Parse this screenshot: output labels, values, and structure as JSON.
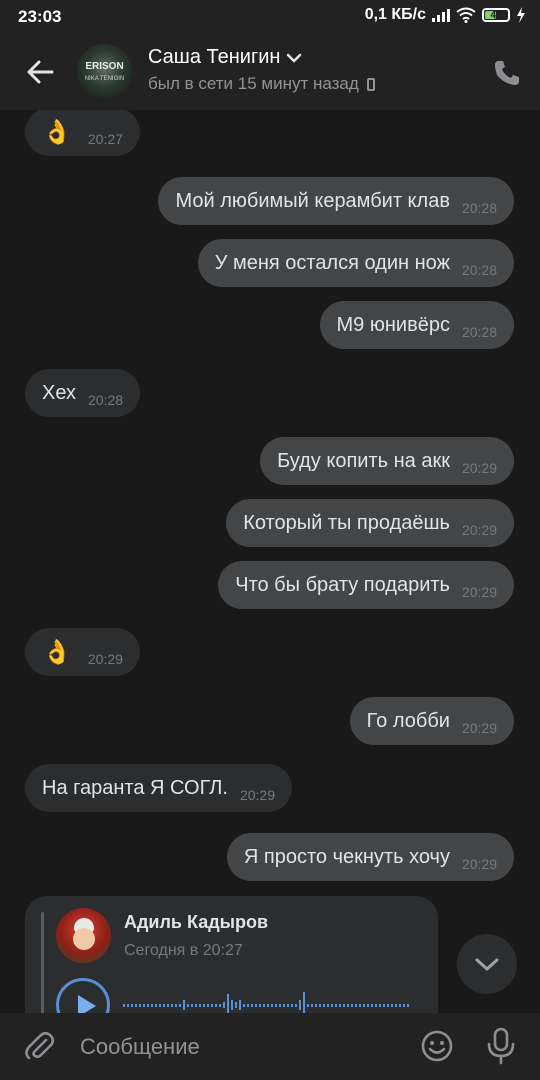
{
  "status_bar": {
    "time": "23:03",
    "speed": "0,1 КБ/с",
    "battery": "47"
  },
  "header": {
    "avatar_line1": "ERISON",
    "avatar_line2": "NIKA TENIGIN",
    "name": "Саша Тенигин",
    "status": "был в сети 15 минут назад"
  },
  "messages": [
    {
      "dir": "in",
      "emoji": "👌",
      "text": "",
      "time": "20:27"
    },
    {
      "dir": "out",
      "emoji": "",
      "text": "Мой любимый керамбит клав",
      "time": "20:28"
    },
    {
      "dir": "out",
      "emoji": "",
      "text": "У меня остался один нож",
      "time": "20:28"
    },
    {
      "dir": "out",
      "emoji": "",
      "text": "М9 юнивёрс",
      "time": "20:28"
    },
    {
      "dir": "in",
      "emoji": "",
      "text": "Хех",
      "time": "20:28"
    },
    {
      "dir": "out",
      "emoji": "",
      "text": "Буду копить на акк",
      "time": "20:29"
    },
    {
      "dir": "out",
      "emoji": "",
      "text": "Который ты продаёшь",
      "time": "20:29"
    },
    {
      "dir": "out",
      "emoji": "",
      "text": "Что бы брату подарить",
      "time": "20:29"
    },
    {
      "dir": "in",
      "emoji": "👌",
      "text": "",
      "time": "20:29"
    },
    {
      "dir": "out",
      "emoji": "",
      "text": "Го лобби",
      "time": "20:29"
    },
    {
      "dir": "in",
      "emoji": "",
      "text": "На гаранта Я СОГЛ.",
      "time": "20:29"
    },
    {
      "dir": "out",
      "emoji": "",
      "text": "Я просто чекнуть хочу",
      "time": "20:29"
    }
  ],
  "forwarded": {
    "author": "Адиль Кадыров",
    "date": "Сегодня в 20:27"
  },
  "composer": {
    "placeholder": "Сообщение"
  },
  "icons": [
    "arrow-left-icon",
    "chevron-down-icon",
    "phone-icon",
    "paperclip-icon",
    "smile-icon",
    "microphone-icon",
    "play-icon",
    "chevron-down-icon"
  ],
  "colors": {
    "background": "#19191a",
    "bar": "#222223",
    "bubble_in": "#2c2d2e",
    "bubble_out": "#444547",
    "accent": "#5a8fd6"
  }
}
